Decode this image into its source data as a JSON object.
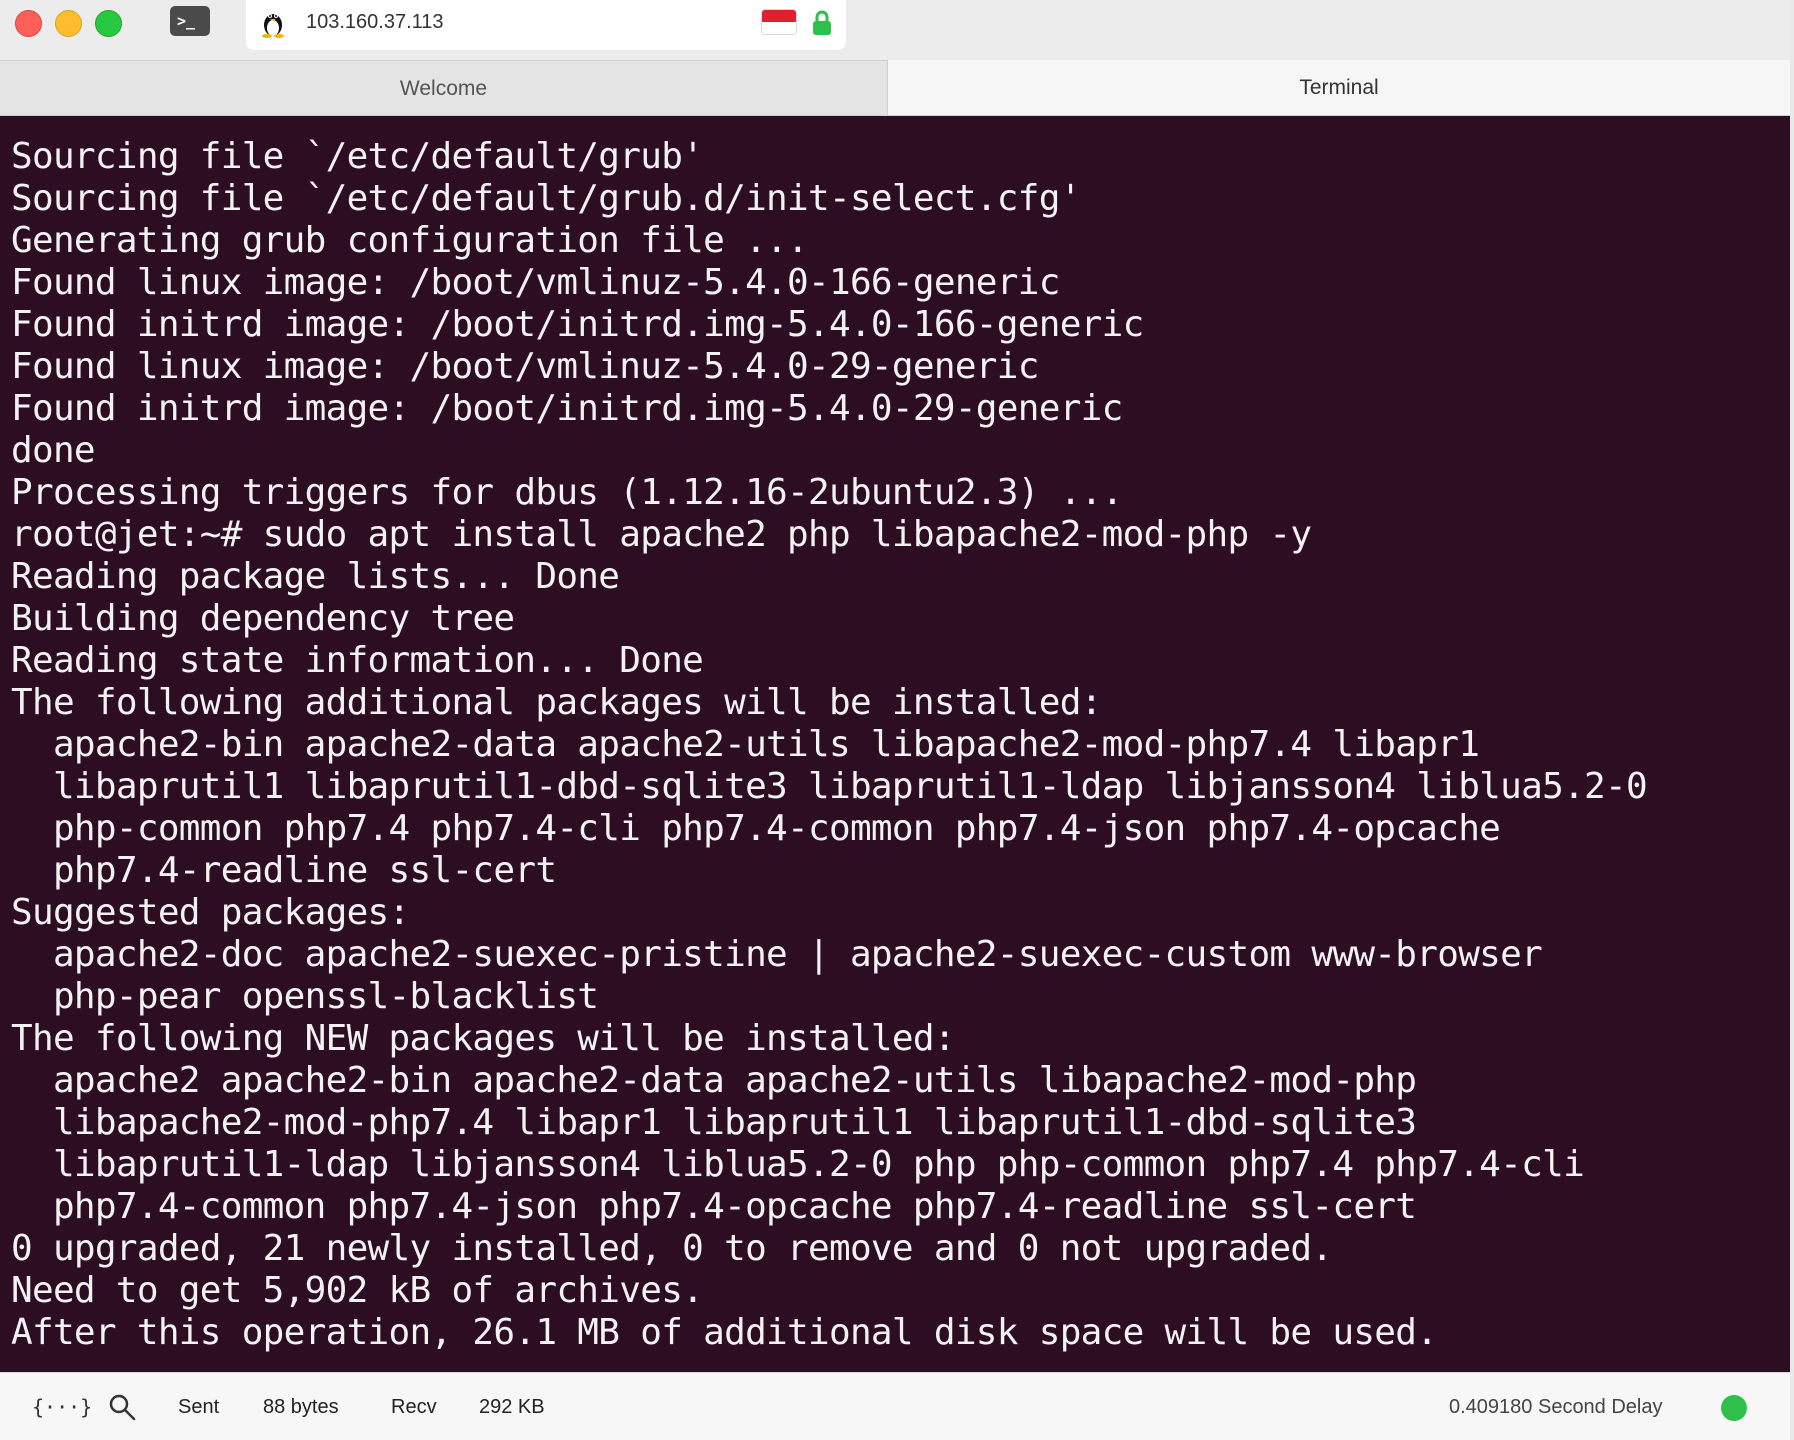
{
  "window": {
    "address": "103.160.37.113",
    "app_icon": "terminal-app-icon",
    "os_icon": "tux-linux-icon",
    "flag_icon": "indonesia-flag-icon",
    "lock_icon": "lock-icon",
    "colors": {
      "terminal_bg": "#2c0d22",
      "terminal_fg": "#f2f2f2",
      "status_connected": "#2ec04a"
    }
  },
  "tabs": [
    {
      "label": "Welcome"
    },
    {
      "label": "Terminal"
    }
  ],
  "terminal": {
    "lines": [
      "Sourcing file `/etc/default/grub'",
      "Sourcing file `/etc/default/grub.d/init-select.cfg'",
      "Generating grub configuration file ...",
      "Found linux image: /boot/vmlinuz-5.4.0-166-generic",
      "Found initrd image: /boot/initrd.img-5.4.0-166-generic",
      "Found linux image: /boot/vmlinuz-5.4.0-29-generic",
      "Found initrd image: /boot/initrd.img-5.4.0-29-generic",
      "done",
      "Processing triggers for dbus (1.12.16-2ubuntu2.3) ...",
      "root@jet:~# sudo apt install apache2 php libapache2-mod-php -y",
      "Reading package lists... Done",
      "Building dependency tree",
      "Reading state information... Done",
      "The following additional packages will be installed:",
      "  apache2-bin apache2-data apache2-utils libapache2-mod-php7.4 libapr1",
      "  libaprutil1 libaprutil1-dbd-sqlite3 libaprutil1-ldap libjansson4 liblua5.2-0",
      "  php-common php7.4 php7.4-cli php7.4-common php7.4-json php7.4-opcache",
      "  php7.4-readline ssl-cert",
      "Suggested packages:",
      "  apache2-doc apache2-suexec-pristine | apache2-suexec-custom www-browser",
      "  php-pear openssl-blacklist",
      "The following NEW packages will be installed:",
      "  apache2 apache2-bin apache2-data apache2-utils libapache2-mod-php",
      "  libapache2-mod-php7.4 libapr1 libaprutil1 libaprutil1-dbd-sqlite3",
      "  libaprutil1-ldap libjansson4 liblua5.2-0 php php-common php7.4 php7.4-cli",
      "  php7.4-common php7.4-json php7.4-opcache php7.4-readline ssl-cert",
      "0 upgraded, 21 newly installed, 0 to remove and 0 not upgraded.",
      "Need to get 5,902 kB of archives.",
      "After this operation, 26.1 MB of additional disk space will be used."
    ]
  },
  "statusbar": {
    "code_icon_glyph": "{···}",
    "sent_label": "Sent",
    "sent_value": "88 bytes",
    "recv_label": "Recv",
    "recv_value": "292 KB",
    "delay_text": "0.409180 Second Delay"
  }
}
